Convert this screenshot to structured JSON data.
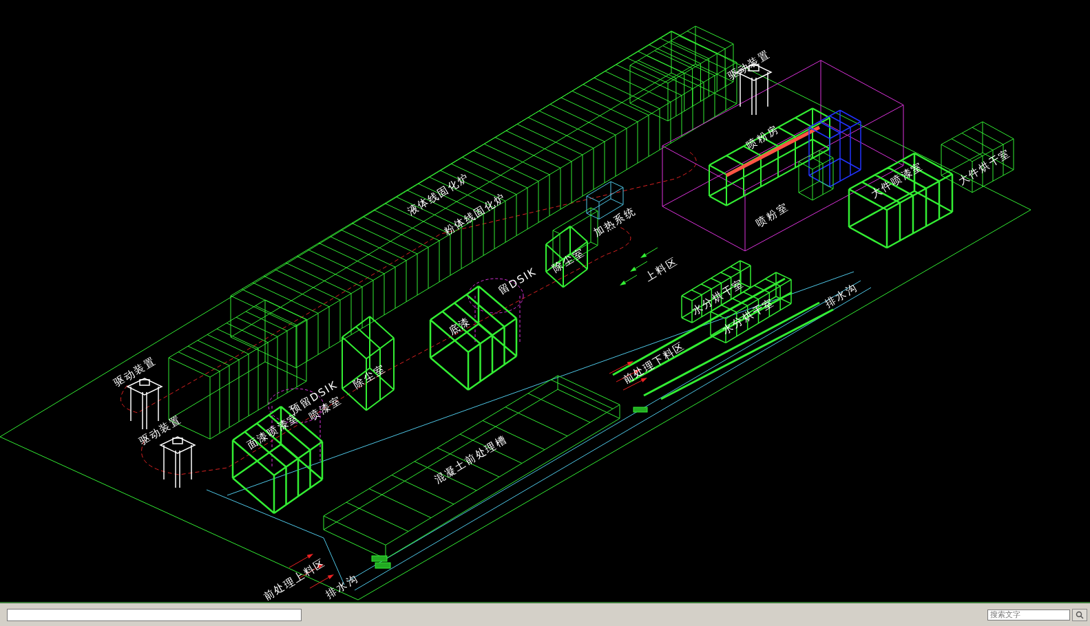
{
  "viewport": {
    "labels": [
      {
        "text": "驱动装置"
      },
      {
        "text": "喷粉房"
      },
      {
        "text": "大件烘干室"
      },
      {
        "text": "液体线固化炉"
      },
      {
        "text": "大件喷漆室"
      },
      {
        "text": "粉体线固化炉"
      },
      {
        "text": "加热系统"
      },
      {
        "text": "喷粉室"
      },
      {
        "text": "除尘室"
      },
      {
        "text": "上料区"
      },
      {
        "text": "留DSIK"
      },
      {
        "text": "水分烘干室"
      },
      {
        "text": "排水沟"
      },
      {
        "text": "水分烘干室"
      },
      {
        "text": "底漆"
      },
      {
        "text": "前处理下料区"
      },
      {
        "text": "驱动装置"
      },
      {
        "text": "除尘室"
      },
      {
        "text": "预留DSIK"
      },
      {
        "text": "喷漆室"
      },
      {
        "text": "驱动装置"
      },
      {
        "text": "面漆喷漆室"
      },
      {
        "text": "混凝土前处理槽"
      },
      {
        "text": "前处理上料区"
      },
      {
        "text": "排水沟"
      }
    ]
  },
  "status_bar": {
    "search_field": {
      "placeholder": "搜索文字"
    }
  }
}
